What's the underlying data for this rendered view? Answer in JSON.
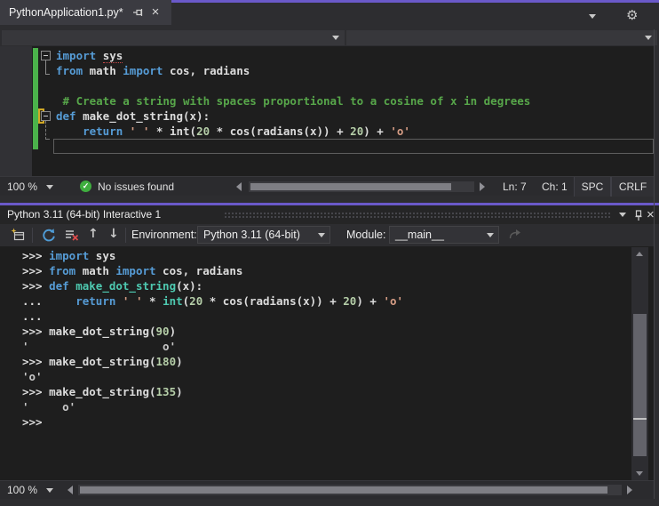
{
  "colors": {
    "accent_purple": "#6a59c9",
    "editor_background": "#1e1e1e",
    "keyword_blue": "#569cd6",
    "comment_green": "#57a64a",
    "string_orange": "#d69d85",
    "number_green": "#b5cea8",
    "function_teal": "#4ec9b0",
    "change_bar_green": "#4bb24b",
    "issue_badge_green": "#3fae3f"
  },
  "tab": {
    "title": "PythonApplication1.py*"
  },
  "editor": {
    "lines": [
      [
        [
          "import",
          "kw"
        ],
        [
          " ",
          "pl"
        ],
        [
          "sys",
          "sq"
        ]
      ],
      [
        [
          "from",
          "kw"
        ],
        [
          " math ",
          "pl"
        ],
        [
          "import",
          "kw"
        ],
        [
          " cos, radians",
          "pl"
        ]
      ],
      [],
      [
        [
          " # Create a string with spaces proportional to a cosine of x in degrees",
          "cm"
        ]
      ],
      [
        [
          "def",
          "kw"
        ],
        [
          " make_dot_string(x):",
          "pl"
        ]
      ],
      [
        [
          "    ",
          "pl"
        ],
        [
          "return",
          "kw"
        ],
        [
          " ",
          "pl"
        ],
        [
          "' '",
          "st"
        ],
        [
          " * int(",
          "pl"
        ],
        [
          "20",
          "nu"
        ],
        [
          " * cos(radians(x)) + ",
          "pl"
        ],
        [
          "20",
          "nu"
        ],
        [
          ") + ",
          "pl"
        ],
        [
          "'o'",
          "st"
        ]
      ],
      []
    ],
    "status": {
      "zoom_level": "100 %",
      "issues_text": "No issues found",
      "line": "Ln: 7",
      "column": "Ch: 1",
      "spaces": "SPC",
      "line_ending": "CRLF"
    }
  },
  "interactive": {
    "title": "Python 3.11 (64-bit) Interactive 1",
    "toolbar": {
      "environment_label": "Environment:",
      "environment_value": "Python 3.11 (64-bit)",
      "module_label": "Module:",
      "module_value": "__main__"
    },
    "lines": [
      [
        [
          ">>> ",
          "pr"
        ],
        [
          "import",
          "kw"
        ],
        [
          " sys",
          "pl"
        ]
      ],
      [
        [
          ">>> ",
          "pr"
        ],
        [
          "from",
          "kw"
        ],
        [
          " math ",
          "pl"
        ],
        [
          "import",
          "kw"
        ],
        [
          " cos, radians",
          "pl"
        ]
      ],
      [
        [
          ">>> ",
          "pr"
        ],
        [
          "def",
          "kw"
        ],
        [
          " ",
          "pl"
        ],
        [
          "make_dot_string",
          "fn"
        ],
        [
          "(x):",
          "pl"
        ]
      ],
      [
        [
          "... ",
          "pr"
        ],
        [
          "    ",
          "pl"
        ],
        [
          "return",
          "kw"
        ],
        [
          " ",
          "pl"
        ],
        [
          "' '",
          "st"
        ],
        [
          " * ",
          "pl"
        ],
        [
          "int",
          "fn"
        ],
        [
          "(",
          "pl"
        ],
        [
          "20",
          "nu"
        ],
        [
          " * cos(radians(x)) + ",
          "pl"
        ],
        [
          "20",
          "nu"
        ],
        [
          ") + ",
          "pl"
        ],
        [
          "'o'",
          "st"
        ]
      ],
      [
        [
          "...",
          "pr"
        ]
      ],
      [
        [
          ">>> ",
          "pr"
        ],
        [
          "make_dot_string(",
          "pl"
        ],
        [
          "90",
          "nu"
        ],
        [
          ")",
          "pl"
        ]
      ],
      [
        [
          "'                    o'",
          "ou"
        ]
      ],
      [
        [
          ">>> ",
          "pr"
        ],
        [
          "make_dot_string(",
          "pl"
        ],
        [
          "180",
          "nu"
        ],
        [
          ")",
          "pl"
        ]
      ],
      [
        [
          "'o'",
          "ou"
        ]
      ],
      [
        [
          ">>> ",
          "pr"
        ],
        [
          "make_dot_string(",
          "pl"
        ],
        [
          "135",
          "nu"
        ],
        [
          ")",
          "pl"
        ]
      ],
      [
        [
          "'     o'",
          "ou"
        ]
      ],
      [
        [
          ">>> ",
          "pr"
        ]
      ]
    ],
    "status": {
      "zoom_level": "100 %"
    }
  }
}
